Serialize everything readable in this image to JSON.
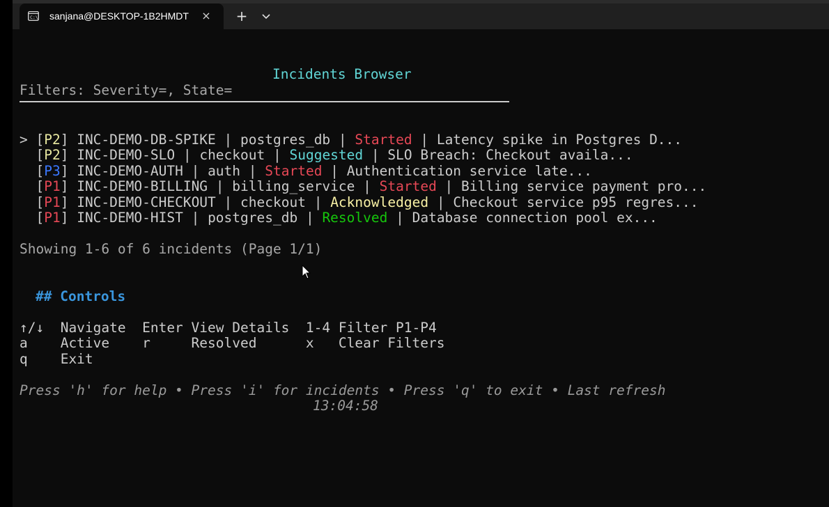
{
  "window": {
    "tab_title": "sanjana@DESKTOP-1B2HMDT",
    "close_glyph": "×",
    "new_tab_glyph": "+",
    "icons": [
      "terminal-icon",
      "close-icon",
      "plus-icon",
      "chevron-down-icon"
    ]
  },
  "terminal": {
    "title": "Incidents Browser",
    "filters": "Filters: Severity=, State=",
    "incidents": [
      {
        "prefix": "> [",
        "priority": "P2",
        "close": "] ",
        "id": "INC-DEMO-DB-SPIKE",
        "sep1": " | ",
        "service": "postgres_db",
        "sep2": " | ",
        "state": "Started",
        "sep3": " | ",
        "summary": "Latency spike in Postgres D..."
      },
      {
        "prefix": "  [",
        "priority": "P2",
        "close": "] ",
        "id": "INC-DEMO-SLO",
        "sep1": " | ",
        "service": "checkout",
        "sep2": " | ",
        "state": "Suggested",
        "sep3": " | ",
        "summary": "SLO Breach: Checkout availa..."
      },
      {
        "prefix": "  [",
        "priority": "P3",
        "close": "] ",
        "id": "INC-DEMO-AUTH",
        "sep1": " | ",
        "service": "auth",
        "sep2": " | ",
        "state": "Started",
        "sep3": " | ",
        "summary": "Authentication service late..."
      },
      {
        "prefix": "  [",
        "priority": "P1",
        "close": "] ",
        "id": "INC-DEMO-BILLING",
        "sep1": " | ",
        "service": "billing_service",
        "sep2": " | ",
        "state": "Started",
        "sep3": " | ",
        "summary": "Billing service payment pro..."
      },
      {
        "prefix": "  [",
        "priority": "P1",
        "close": "] ",
        "id": "INC-DEMO-CHECKOUT",
        "sep1": " | ",
        "service": "checkout",
        "sep2": " | ",
        "state": "Acknowledged",
        "sep3": " | ",
        "summary": "Checkout service p95 regres..."
      },
      {
        "prefix": "  [",
        "priority": "P1",
        "close": "] ",
        "id": "INC-DEMO-HIST",
        "sep1": " | ",
        "service": "postgres_db",
        "sep2": " | ",
        "state": "Resolved",
        "sep3": " | ",
        "summary": "Database connection pool ex..."
      }
    ],
    "showing": "Showing 1-6 of 6 incidents (Page 1/1)",
    "controls_heading": "## Controls",
    "controls_rows": [
      "↑/↓  Navigate  Enter View Details  1-4 Filter P1-P4",
      "a    Active    r     Resolved      x   Clear Filters",
      "q    Exit"
    ],
    "help_line1": "Press 'h' for help • Press 'i' for incidents • Press 'q' to exit • Last refresh",
    "help_line2": "13:04:58"
  },
  "colors": {
    "background": "#0c0c0c",
    "title": "#61d6d6",
    "started": "#e74856",
    "suggested": "#61d6d6",
    "acknowledged": "#f9f1a5",
    "resolved": "#16c60c",
    "p3": "#3b78ff",
    "controls_heading": "#3a96dd"
  }
}
